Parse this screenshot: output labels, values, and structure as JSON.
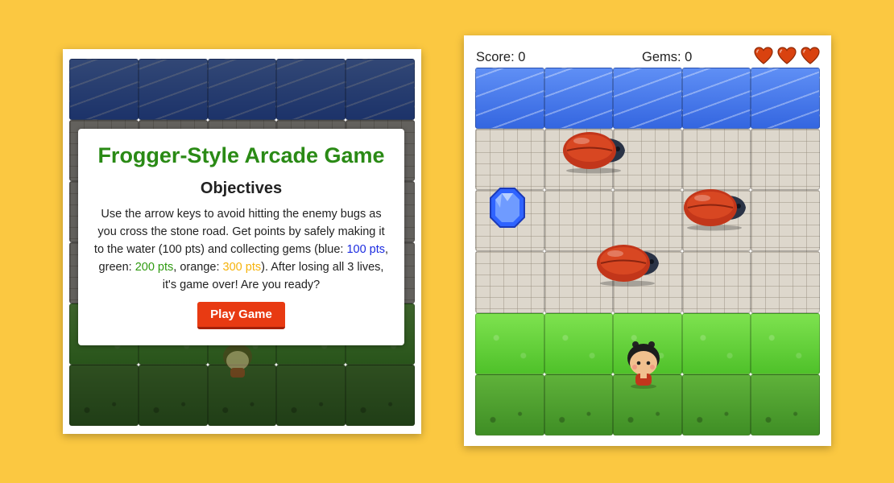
{
  "intro_screen": {
    "title": "Frogger-Style Arcade Game",
    "subtitle": "Objectives",
    "text_part1": "Use the arrow keys to avoid hitting the enemy bugs as you cross the stone road. Get points by safely making it to the water (100 pts) and collecting gems (blue: ",
    "blue_points": "100 pts",
    "text_part2": ", green: ",
    "green_points": "200 pts",
    "text_part3": ", orange: ",
    "orange_points": "300 pts",
    "text_part4": "). After losing all 3 lives, it's game over! Are you ready?",
    "play_button_label": "Play Game"
  },
  "hud": {
    "score_text": "Score: 0",
    "gems_text": "Gems: 0",
    "lives": 3
  },
  "board": {
    "columns": 5,
    "rows": [
      "water",
      "stone",
      "stone",
      "stone",
      "grass",
      "grass-dark"
    ]
  },
  "colors": {
    "background": "#fbc841",
    "title_green": "#2a8a15",
    "button_red": "#e83a12",
    "gem_blue": "#1b2be0",
    "gem_green": "#2f9a10",
    "gem_orange": "#f6b30b"
  },
  "icons": [
    "heart-icon",
    "enemy-bug-icon",
    "blue-gem-icon",
    "player-character-icon"
  ]
}
